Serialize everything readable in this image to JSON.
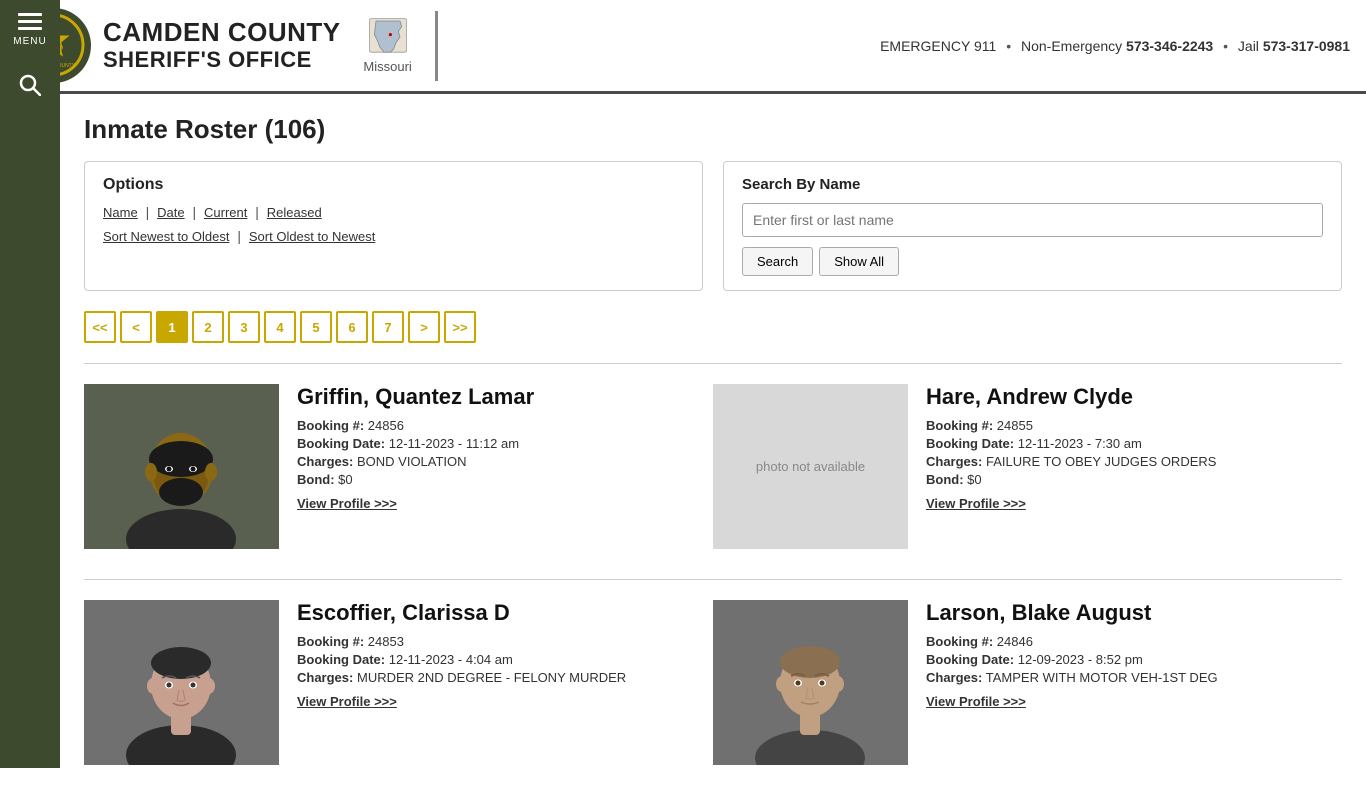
{
  "header": {
    "agency_name_line1": "CAMDEN COUNTY",
    "agency_name_line2": "SHERIFF'S OFFICE",
    "state_label": "Missouri",
    "emergency_label": "EMERGENCY 911",
    "separator1": "•",
    "non_emergency_label": "Non-Emergency",
    "non_emergency_number": "573-346-2243",
    "separator2": "•",
    "jail_label": "Jail",
    "jail_number": "573-317-0981"
  },
  "sidebar": {
    "menu_label": "MENU"
  },
  "page": {
    "title": "Inmate Roster (106)"
  },
  "options": {
    "title": "Options",
    "filter_name": "Name",
    "filter_date": "Date",
    "filter_current": "Current",
    "filter_released": "Released",
    "sort_newest": "Sort Newest to Oldest",
    "sort_oldest": "Sort Oldest to Newest"
  },
  "search": {
    "title": "Search By Name",
    "placeholder": "Enter first or last name",
    "search_btn": "Search",
    "show_all_btn": "Show All"
  },
  "pagination": {
    "first": "<<",
    "prev": "<",
    "pages": [
      "1",
      "2",
      "3",
      "4",
      "5",
      "6",
      "7"
    ],
    "next": ">",
    "last": ">>"
  },
  "inmates": [
    {
      "id": 1,
      "name": "Griffin, Quantez Lamar",
      "booking_num": "24856",
      "booking_date": "12-11-2023 - 11:12 am",
      "charges": "BOND VIOLATION",
      "bond": "$0",
      "view_profile": "View Profile >>>",
      "has_photo": true,
      "photo_color": "#8a7060"
    },
    {
      "id": 2,
      "name": "Hare, Andrew Clyde",
      "booking_num": "24855",
      "booking_date": "12-11-2023 - 7:30 am",
      "charges": "FAILURE TO OBEY JUDGES ORDERS",
      "bond": "$0",
      "view_profile": "View Profile >>>",
      "has_photo": false,
      "photo_text": "photo not available"
    },
    {
      "id": 3,
      "name": "Escoffier, Clarissa D",
      "booking_num": "24853",
      "booking_date": "12-11-2023 - 4:04 am",
      "charges": "MURDER 2ND DEGREE - FELONY MURDER",
      "bond": "",
      "view_profile": "View Profile >>>",
      "has_photo": true,
      "photo_color": "#a09080"
    },
    {
      "id": 4,
      "name": "Larson, Blake August",
      "booking_num": "24846",
      "booking_date": "12-09-2023 - 8:52 pm",
      "charges": "TAMPER WITH MOTOR VEH-1ST DEG",
      "bond": "",
      "view_profile": "View Profile >>>",
      "has_photo": true,
      "photo_color": "#9a8878"
    }
  ],
  "labels": {
    "booking_num": "Booking #:",
    "booking_date": "Booking Date:",
    "charges": "Charges:",
    "bond": "Bond:"
  }
}
